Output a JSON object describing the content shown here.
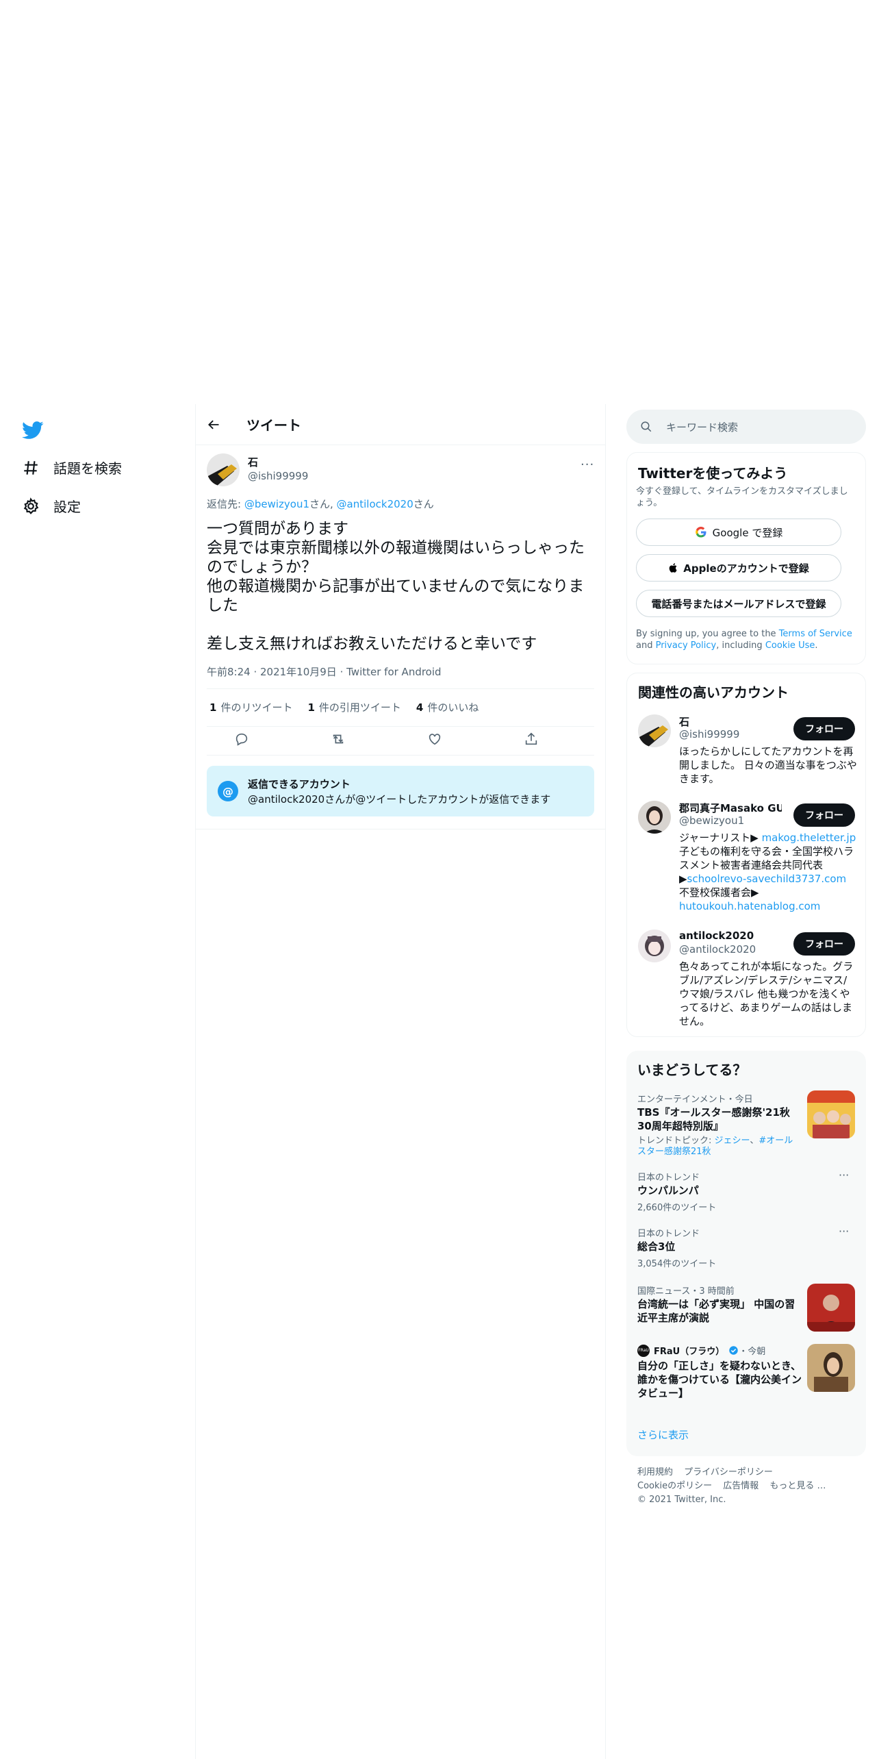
{
  "nav": {
    "explore": "話題を検索",
    "settings": "設定"
  },
  "header": {
    "title": "ツイート"
  },
  "tweet": {
    "name": "石",
    "handle": "@ishi99999",
    "more": "···",
    "reply_to_prefix": "返信先: ",
    "reply_to_user1": "@bewizyou1",
    "reply_to_mid": "さん, ",
    "reply_to_user2": "@antilock2020",
    "reply_to_suffix": "さん",
    "text": "一つ質問があります\n会見では東京新聞様以外の報道機関はいらっしゃったのでしょうか？\n他の報道機関から記事が出ていませんので気になりました\n\n差し支え無ければお教えいただけると幸いです",
    "time": "午前8:24",
    "date": "2021年10月9日",
    "client": "Twitter for Android",
    "meta_sep": " · ",
    "retweets_count": "1",
    "retweets_label": "件のリツイート",
    "quotes_count": "1",
    "quotes_label": "件の引用ツイート",
    "likes_count": "4",
    "likes_label": "件のいいね"
  },
  "reply_restriction": {
    "icon": "@",
    "title": "返信できるアカウント",
    "text": "@antilock2020さんが@ツイートしたアカウントが返信できます"
  },
  "search": {
    "placeholder": "キーワード検索"
  },
  "signup": {
    "title": "Twitterを使ってみよう",
    "subtitle": "今すぐ登録して、タイムラインをカスタマイズしましょう。",
    "google": "Google で登録",
    "apple": "Appleのアカウントで登録",
    "phone": "電話番号またはメールアドレスで登録",
    "legal_1": "By signing up, you agree to the ",
    "legal_terms": "Terms of Service",
    "legal_2": " and ",
    "legal_privacy": "Privacy Policy",
    "legal_3": ", including ",
    "legal_cookie": "Cookie Use",
    "legal_4": "."
  },
  "related": {
    "title": "関連性の高いアカウント",
    "follow_label": "フォロー",
    "accounts": [
      {
        "name": "石",
        "handle": "@ishi99999",
        "bio": "ほったらかしにしてたアカウントを再開しました。 日々の適当な事をつぶやきます。"
      },
      {
        "name": "郡司真子Masako GUN…",
        "handle": "@bewizyou1",
        "bio_1": "ジャーナリスト▶ ",
        "link_1": "makog.theletter.jp",
        "bio_2": "子どもの権利を守る会・全国学校ハラスメント被害者連絡会共同代表▶",
        "link_2": "schoolrevo-savechild3737.com",
        "bio_3": " 不登校保護者会▶",
        "link_3": "hutoukouh.hatenablog.com"
      },
      {
        "name": "antilock2020",
        "handle": "@antilock2020",
        "bio": "色々あってこれが本垢になった。グラブル/アズレン/デレステ/シャニマス/ウマ娘/ラスバレ 他も幾つかを浅くやってるけど、あまりゲームの話はしません。"
      }
    ]
  },
  "trends": {
    "title": "いまどうしてる？",
    "items": [
      {
        "category": "エンターテインメント・今日",
        "title": "TBS『オールスター感謝祭'21秋 30周年超特別版』",
        "topic_prefix": "トレンドトピック: ",
        "topic_1": "ジェシー",
        "topic_sep": "、",
        "topic_2": "#オールスター感謝祭21秋"
      },
      {
        "category": "日本のトレンド",
        "title": "ウンパルンパ",
        "count": "2,660件のツイート",
        "more": "···"
      },
      {
        "category": "日本のトレンド",
        "title": "総合3位",
        "count": "3,054件のツイート",
        "more": "···"
      },
      {
        "category": "国際ニュース・3 時間前",
        "title": "台湾統一は「必ず実現」 中国の習近平主席が演説"
      },
      {
        "source": "FRaU（フラウ）",
        "time": "・今朝",
        "source_badge": "FRaU",
        "title": "自分の「正しさ」を疑わないとき、誰かを傷つけている【瀧内公美インタビュー】"
      }
    ],
    "show_more": "さらに表示"
  },
  "footer": {
    "links_row1": [
      "利用規約",
      "プライバシーポリシー"
    ],
    "links_row2": [
      "Cookieのポリシー",
      "広告情報",
      "もっと見る …"
    ],
    "copyright": "© 2021 Twitter, Inc."
  }
}
